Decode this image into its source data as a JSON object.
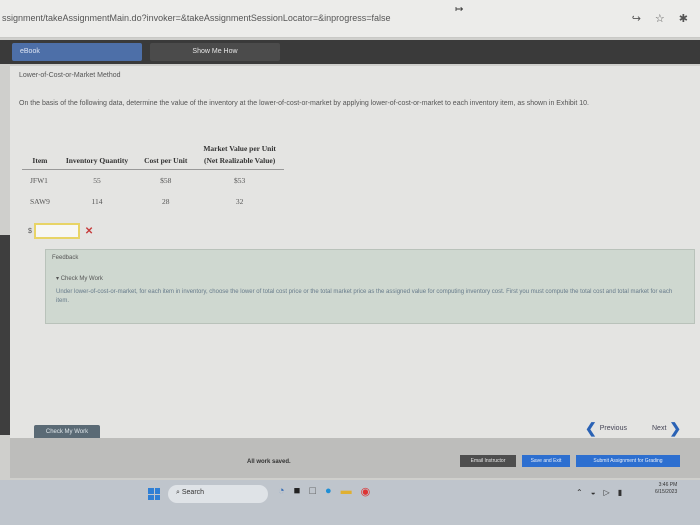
{
  "browser": {
    "url": "ssignment/takeAssignmentMain.do?invoker=&takeAssignmentSessionLocator=&inprogress=false",
    "icons": [
      "share-icon",
      "star-icon",
      "extensions-icon"
    ]
  },
  "nav": {
    "ebook_label": "eBook",
    "show_me_how_label": "Show Me How"
  },
  "question": {
    "title": "Lower-of-Cost-or-Market Method",
    "instructions": "On the basis of the following data, determine the value of the inventory at the lower-of-cost-or-market by applying lower-of-cost-or-market to each inventory item, as shown in Exhibit 10."
  },
  "table": {
    "headers": {
      "item": "Item",
      "quantity": "Inventory Quantity",
      "cost": "Cost per Unit",
      "market_line1": "Market Value per Unit",
      "market_line2": "(Net Realizable Value)"
    },
    "rows": [
      {
        "item": "JFW1",
        "quantity": "55",
        "cost": "$58",
        "market": "$53"
      },
      {
        "item": "SAW9",
        "quantity": "114",
        "cost": "28",
        "market": "32"
      }
    ]
  },
  "answer": {
    "currency": "$",
    "value": "",
    "status_icon": "x-wrong-icon"
  },
  "feedback": {
    "label": "Feedback",
    "check_my_work_title": "Check My Work",
    "text": "Under lower-of-cost-or-market, for each item in inventory, choose the lower of total cost price or the total market price as the assigned value for computing inventory cost. First you must compute the total cost and total market for each item."
  },
  "buttons": {
    "check_my_work": "Check My Work",
    "previous": "Previous",
    "next": "Next"
  },
  "footer": {
    "status": "All work saved.",
    "email_instructor": "Email Instructor",
    "save_and_exit": "Save and Exit",
    "submit": "Submit Assignment for Grading"
  },
  "taskbar": {
    "search_label": "Search",
    "clock_time": "3:46 PM",
    "clock_date": "6/15/2023"
  }
}
